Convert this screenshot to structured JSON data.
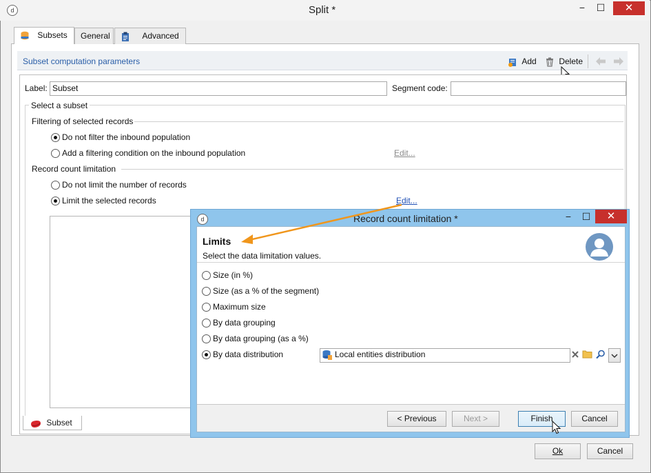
{
  "window": {
    "title": "Split *",
    "app_icon": "d",
    "controls": {
      "minimize": "−",
      "maximize": "☐",
      "close": "✕"
    }
  },
  "tabs": [
    {
      "label": "Subsets",
      "icon": "database-icon",
      "active": true
    },
    {
      "label": "General",
      "active": false
    },
    {
      "label": "Advanced",
      "icon": "clipboard-icon",
      "active": false
    }
  ],
  "section": {
    "title": "Subset computation parameters",
    "add_label": "Add",
    "delete_label": "Delete"
  },
  "form": {
    "label_caption": "Label:",
    "label_value": "Subset",
    "segment_code_caption": "Segment code:",
    "segment_code_value": "",
    "select_subset": "Select a subset",
    "filtering": {
      "heading": "Filtering of selected records",
      "opt1": "Do not filter the inbound population",
      "opt2": "Add a filtering condition on the inbound population",
      "edit": "Edit...",
      "selected": 0
    },
    "count": {
      "heading": "Record count limitation",
      "opt1": "Do not limit the number of records",
      "opt2": "Limit the selected records",
      "edit": "Edit...",
      "selected": 1
    },
    "bottom_tab": "Subset"
  },
  "dialog": {
    "title": "Record count limitation *",
    "heading": "Limits",
    "description": "Select the data limitation values.",
    "options": [
      "Size (in %)",
      "Size (as a % of the segment)",
      "Maximum size",
      "By data grouping",
      "By data grouping (as a %)",
      "By data distribution"
    ],
    "selected_index": 5,
    "distribution_value": "Local entities distribution",
    "buttons": {
      "previous": "< Previous",
      "next": "Next >",
      "finish": "Finish",
      "cancel": "Cancel"
    }
  },
  "footer": {
    "ok": "Ok",
    "cancel": "Cancel"
  },
  "colors": {
    "accent": "#2a5ea8",
    "close_red": "#c7302c",
    "dialog_frame": "#8fc5ec",
    "annotation_arrow": "#f0961c"
  }
}
